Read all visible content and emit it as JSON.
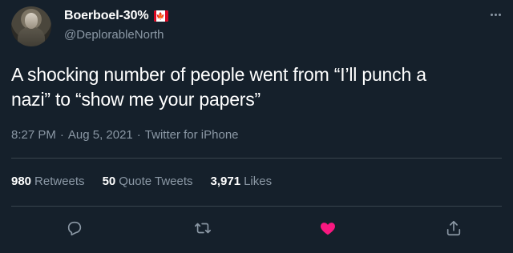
{
  "user": {
    "display_name": "Boerboel-30%",
    "handle": "@DeplorableNorth",
    "flag_icon": "canada-flag-icon"
  },
  "tweet": {
    "text": "A shocking number of people went from “I’ll punch a\nnazi” to “show me your papers”",
    "time": "8:27 PM",
    "separator": "·",
    "date": "Aug 5, 2021",
    "source": "Twitter for iPhone"
  },
  "stats": {
    "retweets": {
      "count": "980",
      "label": "Retweets"
    },
    "quotes": {
      "count": "50",
      "label": "Quote Tweets"
    },
    "likes": {
      "count": "3,971",
      "label": "Likes"
    }
  },
  "actions": {
    "reply_icon": "reply-icon",
    "retweet_icon": "retweet-icon",
    "like_icon": "heart-icon",
    "share_icon": "share-icon",
    "liked": true
  },
  "colors": {
    "background": "#15202b",
    "muted_text": "#8b98a5",
    "divider": "#38444d",
    "like": "#f91880"
  }
}
